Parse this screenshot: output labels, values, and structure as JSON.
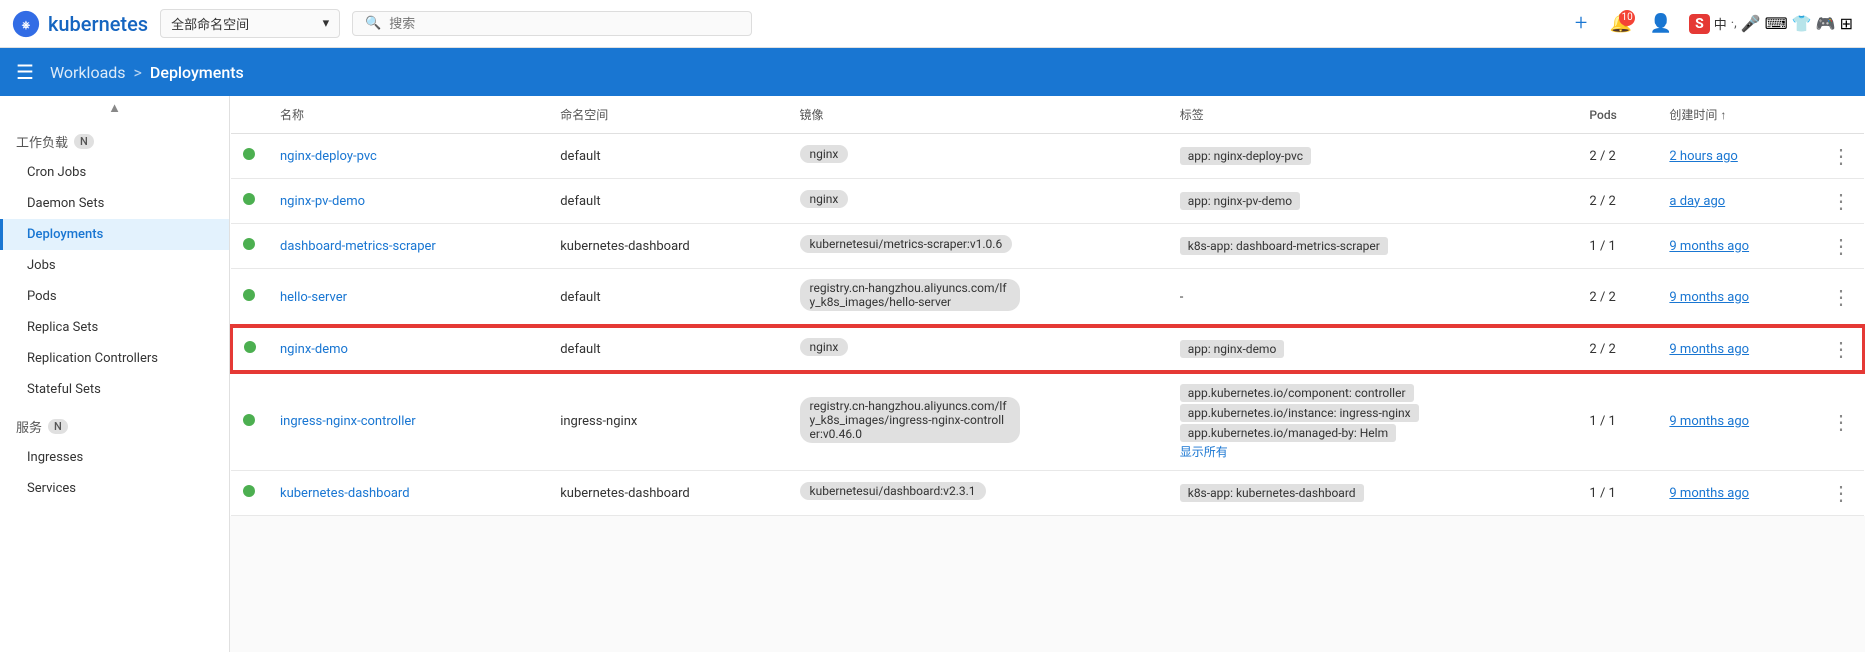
{
  "navbar": {
    "logo_text": "kubernetes",
    "namespace_label": "全部命名空间",
    "search_placeholder": "搜索",
    "plus_icon": "+",
    "notification_count": "10",
    "user_icon": "👤"
  },
  "breadcrumb": {
    "parent": "Workloads",
    "separator": ">",
    "current": "Deployments"
  },
  "sidebar": {
    "section1_label": "工作负载",
    "section1_badge": "N",
    "items_workloads": [
      {
        "id": "cron-jobs",
        "label": "Cron Jobs",
        "active": false
      },
      {
        "id": "daemon-sets",
        "label": "Daemon Sets",
        "active": false
      },
      {
        "id": "deployments",
        "label": "Deployments",
        "active": true
      },
      {
        "id": "jobs",
        "label": "Jobs",
        "active": false
      },
      {
        "id": "pods",
        "label": "Pods",
        "active": false
      },
      {
        "id": "replica-sets",
        "label": "Replica Sets",
        "active": false
      },
      {
        "id": "replication-controllers",
        "label": "Replication Controllers",
        "active": false
      },
      {
        "id": "stateful-sets",
        "label": "Stateful Sets",
        "active": false
      }
    ],
    "section2_label": "服务",
    "section2_badge": "N",
    "items_services": [
      {
        "id": "ingresses",
        "label": "Ingresses",
        "active": false
      },
      {
        "id": "services",
        "label": "Services",
        "active": false
      }
    ]
  },
  "table": {
    "columns": [
      {
        "id": "status",
        "label": ""
      },
      {
        "id": "name",
        "label": "名称"
      },
      {
        "id": "namespace",
        "label": "命名空间"
      },
      {
        "id": "image",
        "label": "镜像"
      },
      {
        "id": "labels",
        "label": "标签"
      },
      {
        "id": "pods",
        "label": "Pods"
      },
      {
        "id": "created",
        "label": "创建时间 ↑"
      },
      {
        "id": "actions",
        "label": ""
      }
    ],
    "rows": [
      {
        "status": "green",
        "name": "nginx-deploy-pvc",
        "namespace": "default",
        "images": [
          "nginx"
        ],
        "labels": [
          "app: nginx-deploy-pvc"
        ],
        "pods": "2 / 2",
        "created": "2 hours ago",
        "highlighted": false
      },
      {
        "status": "green",
        "name": "nginx-pv-demo",
        "namespace": "default",
        "images": [
          "nginx"
        ],
        "labels": [
          "app: nginx-pv-demo"
        ],
        "pods": "2 / 2",
        "created": "a day ago",
        "highlighted": false
      },
      {
        "status": "green",
        "name": "dashboard-metrics-scraper",
        "namespace": "kubernetes-dashboard",
        "images": [
          "kubernetesui/metrics-scraper:v1.0.6"
        ],
        "labels": [
          "k8s-app: dashboard-metrics-scraper"
        ],
        "pods": "1 / 1",
        "created": "9 months ago",
        "highlighted": false
      },
      {
        "status": "green",
        "name": "hello-server",
        "namespace": "default",
        "images": [
          "registry.cn-hangzhou.aliyuncs.com/lfy_k8s_images/hello-server"
        ],
        "labels": [
          "-"
        ],
        "pods": "2 / 2",
        "created": "9 months ago",
        "highlighted": false
      },
      {
        "status": "green",
        "name": "nginx-demo",
        "namespace": "default",
        "images": [
          "nginx"
        ],
        "labels": [
          "app: nginx-demo"
        ],
        "pods": "2 / 2",
        "created": "9 months ago",
        "highlighted": true
      },
      {
        "status": "green",
        "name": "ingress-nginx-controller",
        "namespace": "ingress-nginx",
        "images": [
          "registry.cn-hangzhou.aliyuncs.com/lfy_k8s_images/ingress-nginx-controller:v0.46.0"
        ],
        "labels": [
          "app.kubernetes.io/component: controller",
          "app.kubernetes.io/instance: ingress-nginx",
          "app.kubernetes.io/managed-by: Helm"
        ],
        "show_all": "显示所有",
        "pods": "1 / 1",
        "created": "9 months ago",
        "highlighted": false
      },
      {
        "status": "green",
        "name": "kubernetes-dashboard",
        "namespace": "kubernetes-dashboard",
        "images": [
          "kubernetesui/dashboard:v2.3.1"
        ],
        "labels": [
          "k8s-app: kubernetes-dashboard"
        ],
        "pods": "1 / 1",
        "created": "9 months ago",
        "highlighted": false
      }
    ]
  }
}
